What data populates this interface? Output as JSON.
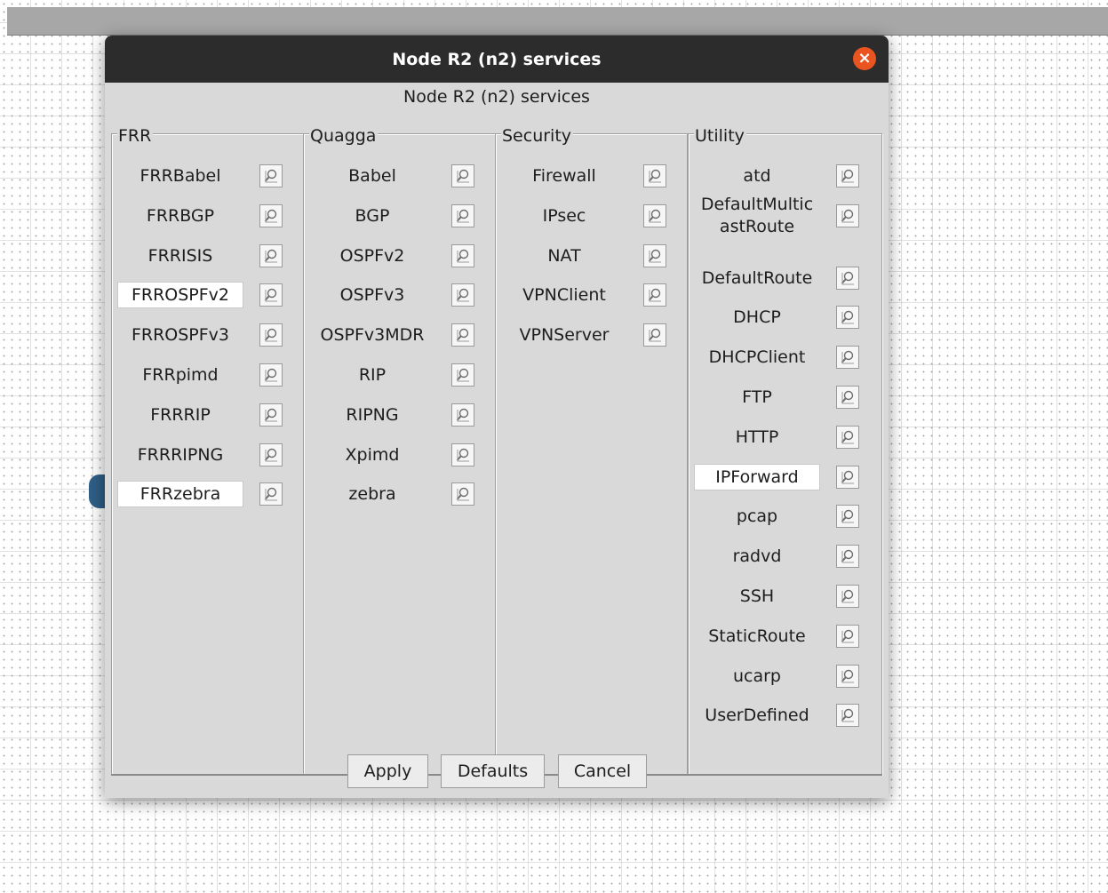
{
  "dialog": {
    "title": "Node R2 (n2) services",
    "subtitle": "Node R2 (n2) services",
    "close_glyph": "×"
  },
  "groups": [
    {
      "title": "FRR",
      "items": [
        {
          "label": "FRRBabel",
          "active": false
        },
        {
          "label": "FRRBGP",
          "active": false
        },
        {
          "label": "FRRISIS",
          "active": false
        },
        {
          "label": "FRROSPFv2",
          "active": true
        },
        {
          "label": "FRROSPFv3",
          "active": false
        },
        {
          "label": "FRRpimd",
          "active": false
        },
        {
          "label": "FRRRIP",
          "active": false
        },
        {
          "label": "FRRRIPNG",
          "active": false
        },
        {
          "label": "FRRzebra",
          "active": true
        }
      ]
    },
    {
      "title": "Quagga",
      "items": [
        {
          "label": "Babel",
          "active": false
        },
        {
          "label": "BGP",
          "active": false
        },
        {
          "label": "OSPFv2",
          "active": false
        },
        {
          "label": "OSPFv3",
          "active": false
        },
        {
          "label": "OSPFv3MDR",
          "active": false
        },
        {
          "label": "RIP",
          "active": false
        },
        {
          "label": "RIPNG",
          "active": false
        },
        {
          "label": "Xpimd",
          "active": false
        },
        {
          "label": "zebra",
          "active": false
        }
      ]
    },
    {
      "title": "Security",
      "items": [
        {
          "label": "Firewall",
          "active": false
        },
        {
          "label": "IPsec",
          "active": false
        },
        {
          "label": "NAT",
          "active": false
        },
        {
          "label": "VPNClient",
          "active": false
        },
        {
          "label": "VPNServer",
          "active": false
        }
      ]
    },
    {
      "title": "Utility",
      "items": [
        {
          "label": "atd",
          "active": false
        },
        {
          "label": "DefaultMulticastRoute",
          "active": false
        },
        {
          "label": "DefaultRoute",
          "active": false
        },
        {
          "label": "DHCP",
          "active": false
        },
        {
          "label": "DHCPClient",
          "active": false
        },
        {
          "label": "FTP",
          "active": false
        },
        {
          "label": "HTTP",
          "active": false
        },
        {
          "label": "IPForward",
          "active": true
        },
        {
          "label": "pcap",
          "active": false
        },
        {
          "label": "radvd",
          "active": false
        },
        {
          "label": "SSH",
          "active": false
        },
        {
          "label": "StaticRoute",
          "active": false
        },
        {
          "label": "ucarp",
          "active": false
        },
        {
          "label": "UserDefined",
          "active": false
        }
      ]
    }
  ],
  "buttons": {
    "apply": "Apply",
    "defaults": "Defaults",
    "cancel": "Cancel"
  },
  "icons": {
    "config": "magnifier-config-icon",
    "close": "close-icon"
  },
  "colors": {
    "titlebar": "#2c2c2c",
    "close_button": "#e95420",
    "dialog_bg": "#d9d9d9",
    "active_item_bg": "#ffffff"
  }
}
